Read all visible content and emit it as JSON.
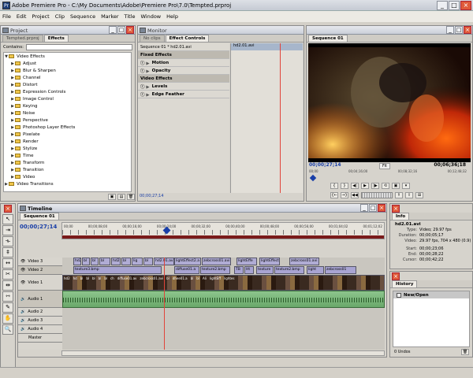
{
  "app": {
    "title": "Adobe Premiere Pro - C:\\My Documents\\Adobe\\Premiere Pro\\7.0\\Tempted.prproj",
    "icon": "Pr"
  },
  "menu": [
    "File",
    "Edit",
    "Project",
    "Clip",
    "Sequence",
    "Marker",
    "Title",
    "Window",
    "Help"
  ],
  "project": {
    "title": "Project",
    "tabs": [
      "Tempted.prproj",
      "Effects"
    ],
    "contains_label": "Contains:",
    "contains_value": "",
    "tree": [
      {
        "label": "Video Effects",
        "level": 0,
        "expanded": true
      },
      {
        "label": "Adjust",
        "level": 1
      },
      {
        "label": "Blur & Sharpen",
        "level": 1
      },
      {
        "label": "Channel",
        "level": 1
      },
      {
        "label": "Distort",
        "level": 1
      },
      {
        "label": "Expression Controls",
        "level": 1
      },
      {
        "label": "Image Control",
        "level": 1
      },
      {
        "label": "Keying",
        "level": 1
      },
      {
        "label": "Noise",
        "level": 1
      },
      {
        "label": "Perspective",
        "level": 1
      },
      {
        "label": "Photoshop Layer Effects",
        "level": 1
      },
      {
        "label": "Pixelate",
        "level": 1
      },
      {
        "label": "Render",
        "level": 1
      },
      {
        "label": "Stylize",
        "level": 1
      },
      {
        "label": "Time",
        "level": 1
      },
      {
        "label": "Transform",
        "level": 1
      },
      {
        "label": "Transition",
        "level": 1
      },
      {
        "label": "Video",
        "level": 1
      },
      {
        "label": "Video Transitions",
        "level": 0
      }
    ]
  },
  "monitor": {
    "title": "Monitor",
    "tabs": [
      "No clips",
      "Effect Controls"
    ],
    "seq_label": "Sequence 01 * hd2.01.avi",
    "clip_name": "hd2.01.avi",
    "fixed_effects": "Fixed Effects",
    "motion": "Motion",
    "opacity": "Opacity",
    "video_effects": "Video Effects",
    "levels": "Levels",
    "edge_feather": "Edge Feather",
    "timecode": "00;00;27;14"
  },
  "program": {
    "tab": "Sequence 01",
    "timecode": "00;00;27;14",
    "duration": "00;06;36;18",
    "fit": "Fit",
    "ruler": [
      "00;00",
      "00;04;16;00",
      "00;08;32;16",
      "00;12;48;32"
    ]
  },
  "timeline": {
    "title": "Timeline",
    "tab": "Sequence 01",
    "timecode": "00;00;27;14",
    "ruler": [
      "00;00",
      "00;00;08;00",
      "00;00;16;00",
      "00;00;24;00",
      "00;00;32;00",
      "00;00;40;00",
      "00;00;48;00",
      "00;00;56;00",
      "00;01;04;02",
      "00;01;12;02"
    ],
    "tracks": [
      "Video 3",
      "Video 2",
      "Video 1",
      "Audio 1",
      "Audio 2",
      "Audio 3",
      "Audio 4",
      "Master"
    ],
    "v3_clips": [
      "hd2.",
      "bl",
      "bl",
      "bl",
      "hd2.",
      "bl",
      "lig",
      "bl",
      "hd2.01.avi",
      "lightEffect2.a",
      "zebcross01.avi",
      "lightEffe",
      "lightEffect1",
      "zebcross01.avi"
    ],
    "v2_clips": [
      "texture3.bmp",
      "diffuse01.a",
      "texture2.bmp",
      "TB",
      "Ht",
      "texture",
      "texture2.bmp",
      "light",
      "zebcross01"
    ],
    "v1_clips": [
      "hd2",
      "hd",
      "bl",
      "bl",
      "bl",
      "bl",
      "bl",
      "ch",
      "diffuse01.av",
      "zebcross01.avi",
      "bl",
      "dhee01.a",
      "bl",
      "bl",
      "Ali",
      "lightEff",
      "lightes"
    ]
  },
  "info": {
    "title": "Info",
    "filename": "hd2.01.avi",
    "type_k": "Type:",
    "type_v": "Video; 29.97 fps",
    "duration_k": "Duration:",
    "duration_v": "00;00;05;17",
    "video_k": "Video:",
    "video_v": "29.97 fps, 704 x 480 (0.9)",
    "start_k": "Start:",
    "start_v": "00;00;23;06",
    "end_k": "End:",
    "end_v": "00;00;28;22",
    "cursor_k": "Cursor:",
    "cursor_v": "00;00;42;22"
  },
  "history": {
    "title": "History",
    "item": "New/Open",
    "footer": "0 Undos"
  }
}
